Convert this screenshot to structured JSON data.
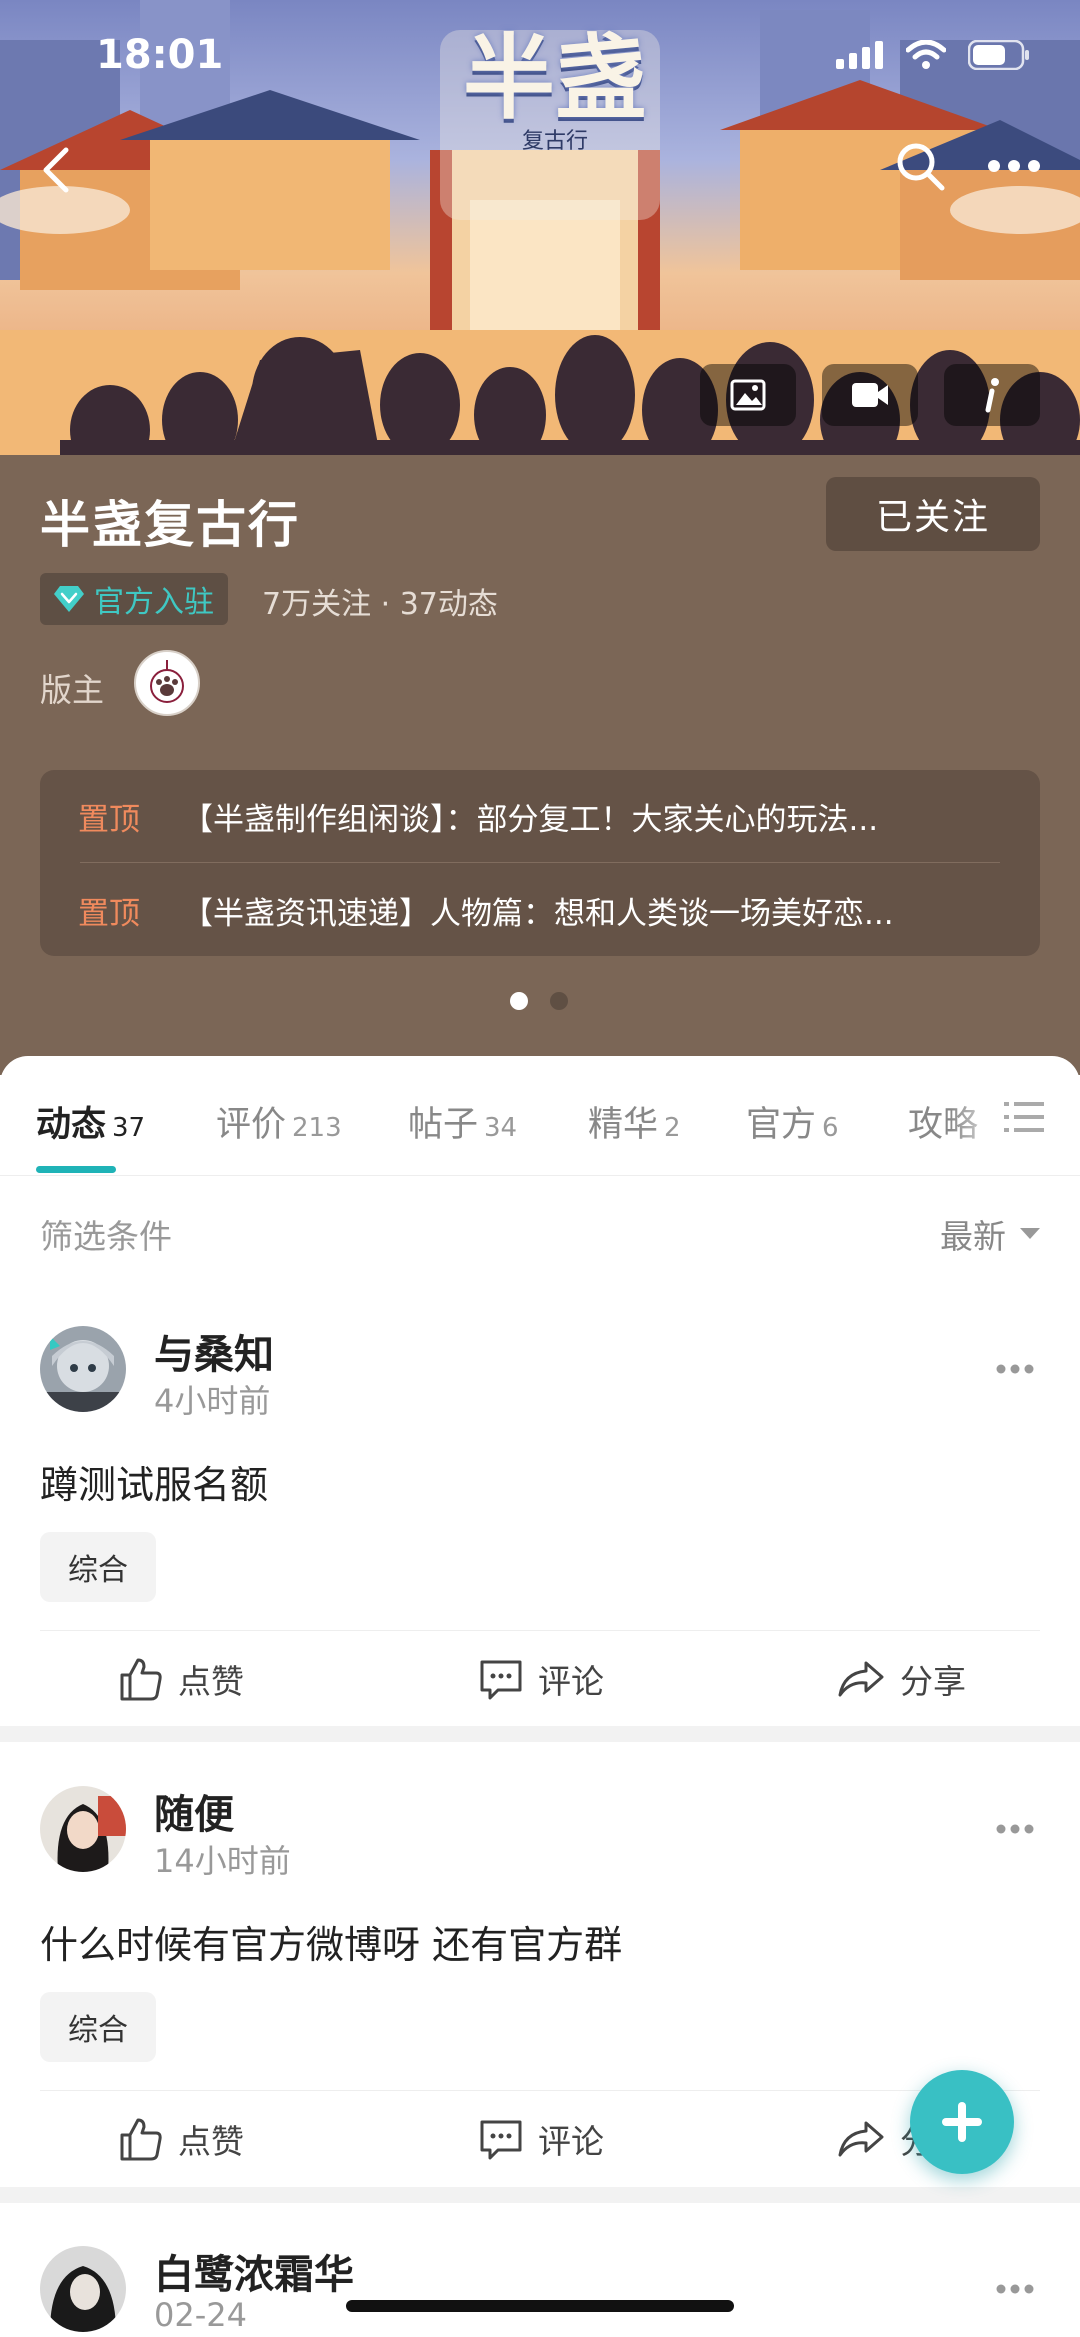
{
  "status_bar": {
    "time": "18:01"
  },
  "banner": {
    "logo_text": "半盏",
    "logo_sub": "复古行"
  },
  "header": {
    "title": "半盏复古行",
    "follow_button": "已关注",
    "official_badge": "官方入驻",
    "stats": "7万关注 · 37动态",
    "moderator_label": "版主"
  },
  "pinned": [
    {
      "tag": "置顶",
      "text": "【半盏制作组闲谈】：部分复工！大家关心的玩法..."
    },
    {
      "tag": "置顶",
      "text": "【半盏资讯速递】人物篇：想和人类谈一场美好恋..."
    }
  ],
  "carousel": {
    "pages": 2,
    "active": 1
  },
  "tabs": [
    {
      "label": "动态",
      "count": "37"
    },
    {
      "label": "评价",
      "count": "213"
    },
    {
      "label": "帖子",
      "count": "34"
    },
    {
      "label": "精华",
      "count": "2"
    },
    {
      "label": "官方",
      "count": "6"
    },
    {
      "label": "攻略",
      "count": ""
    }
  ],
  "filter": {
    "label": "筛选条件",
    "sort": "最新"
  },
  "posts": [
    {
      "author": "与桑知",
      "time": "4小时前",
      "text": "蹲测试服名额",
      "tag": "综合"
    },
    {
      "author": "随便",
      "time": "14小时前",
      "text": "什么时候有官方微博呀 还有官方群",
      "tag": "综合"
    },
    {
      "author": "白鹭浓霜华",
      "time": "02-24"
    }
  ],
  "actions": {
    "like": "点赞",
    "comment": "评论",
    "share": "分享"
  },
  "colors": {
    "accent": "#1fb3b7",
    "header_bg": "#7b6656",
    "pinned_tag": "#f08a5d"
  }
}
